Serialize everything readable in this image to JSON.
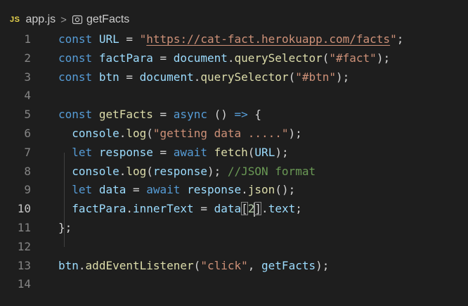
{
  "breadcrumb": {
    "lang_badge": "JS",
    "file": "app.js",
    "separator": ">",
    "symbol_icon": "symbol-method-icon",
    "symbol": "getFacts"
  },
  "editor": {
    "active_line": 10,
    "lines": [
      {
        "number": "1",
        "text": "const URL = \"https://cat-fact.herokuapp.com/facts\";"
      },
      {
        "number": "2",
        "text": "const factPara = document.querySelector(\"#fact\");"
      },
      {
        "number": "3",
        "text": "const btn = document.querySelector(\"#btn\");"
      },
      {
        "number": "4",
        "text": ""
      },
      {
        "number": "5",
        "text": "const getFacts = async () => {"
      },
      {
        "number": "6",
        "text": "  console.log(\"getting data .....\");"
      },
      {
        "number": "7",
        "text": "  let response = await fetch(URL);"
      },
      {
        "number": "8",
        "text": "  console.log(response); //JSON format"
      },
      {
        "number": "9",
        "text": "  let data = await response.json();"
      },
      {
        "number": "10",
        "text": "  factPara.innerText = data[2].text;"
      },
      {
        "number": "11",
        "text": "};"
      },
      {
        "number": "12",
        "text": ""
      },
      {
        "number": "13",
        "text": "btn.addEventListener(\"click\", getFacts);"
      },
      {
        "number": "14",
        "text": ""
      }
    ]
  },
  "colors": {
    "background": "#1e1e1e",
    "keyword": "#569cd6",
    "variable": "#9cdcfe",
    "function": "#dcdcaa",
    "string": "#ce9178",
    "comment": "#6a9955",
    "number": "#b5cea8",
    "line_number": "#858585"
  }
}
